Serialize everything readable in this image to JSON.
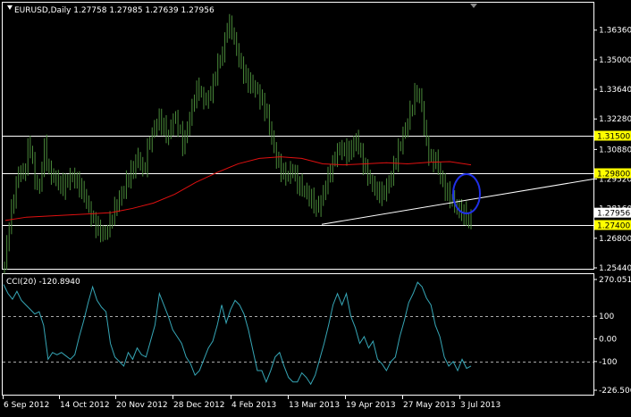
{
  "header": {
    "symbol_line": "EURUSD,Daily  1.27758 1.27985 1.27639 1.27956"
  },
  "indicator": {
    "title": "CCI(20) -120.8940",
    "axis_labels": [
      "270.051",
      "100",
      "0.00",
      "-100",
      "-226.5064"
    ],
    "level_values": [
      270.051,
      100,
      0,
      -100,
      -226.5064
    ]
  },
  "price_axis": {
    "labels": [
      "1.36360",
      "1.35000",
      "1.33640",
      "1.32280",
      "1.30880",
      "1.29520",
      "1.28160",
      "1.26800",
      "1.25440"
    ],
    "values": [
      1.3636,
      1.35,
      1.3364,
      1.3228,
      1.3088,
      1.2952,
      1.2816,
      1.268,
      1.2544
    ],
    "current_price": "1.27956",
    "current_value": 1.27956
  },
  "levels": [
    {
      "label": "1.31500",
      "value": 1.315
    },
    {
      "label": "1.29800",
      "value": 1.298
    },
    {
      "label": "1.27400",
      "value": 1.274
    }
  ],
  "time_axis": {
    "labels": [
      "6 Sep 2012",
      "14 Oct 2012",
      "20 Nov 2012",
      "28 Dec 2012",
      "4 Feb 2013",
      "13 Mar 2013",
      "19 Apr 2013",
      "27 May 2013",
      "3 Jul 2013"
    ]
  },
  "colors": {
    "background": "#000000",
    "grid_frame": "#ffffff",
    "candle": "#4a8a3a",
    "moving_average": "#e01010",
    "trendline": "#ffffff",
    "level_line": "#ffffff",
    "level_label_bg": "#ffff00",
    "cci_line": "#36a6b6",
    "highlight_circle": "#2030e8"
  },
  "chart_data": {
    "type": "candlestick",
    "symbol": "EURUSD",
    "timeframe": "Daily",
    "ohlc_last": {
      "open": 1.27758,
      "high": 1.27985,
      "low": 1.27639,
      "close": 1.27956
    },
    "x_labels": [
      "6 Sep 2012",
      "14 Oct 2012",
      "20 Nov 2012",
      "28 Dec 2012",
      "4 Feb 2013",
      "13 Mar 2013",
      "19 Apr 2013",
      "27 May 2013",
      "3 Jul 2013"
    ],
    "ylim": [
      1.2544,
      1.3758
    ],
    "close_path": [
      1.2555,
      1.2752,
      1.2882,
      1.3002,
      1.2962,
      1.3142,
      1.2962,
      1.2896,
      1.3102,
      1.2982,
      1.2962,
      1.2932,
      1.2912,
      1.2962,
      1.2962,
      1.2922,
      1.2887,
      1.2812,
      1.2752,
      1.2722,
      1.2692,
      1.2732,
      1.2802,
      1.2852,
      1.2902,
      1.2962,
      1.3002,
      1.3062,
      1.2972,
      1.3112,
      1.3172,
      1.3232,
      1.3192,
      1.3142,
      1.3232,
      1.3202,
      1.3102,
      1.3202,
      1.3302,
      1.3382,
      1.3312,
      1.3322,
      1.3382,
      1.3482,
      1.3532,
      1.3672,
      1.3622,
      1.3522,
      1.3452,
      1.3402,
      1.3382,
      1.3352,
      1.3302,
      1.3242,
      1.3122,
      1.3032,
      1.2982,
      1.2962,
      1.3002,
      1.2932,
      1.2912,
      1.2882,
      1.2852,
      1.2812,
      1.2862,
      1.2952,
      1.3012,
      1.3082,
      1.3092,
      1.3072,
      1.3092,
      1.3142,
      1.3042,
      1.2982,
      1.2932,
      1.2892,
      1.2882,
      1.2912,
      1.2972,
      1.3052,
      1.3132,
      1.3192,
      1.3282,
      1.3362,
      1.3302,
      1.3112,
      1.3032,
      1.3042,
      1.2952,
      1.2892,
      1.2862,
      1.2822,
      1.2802,
      1.2782,
      1.2752
    ],
    "ma_path": [
      1.2762,
      1.2777,
      1.2782,
      1.2787,
      1.2792,
      1.2798,
      1.2817,
      1.2842,
      1.2882,
      1.2937,
      1.2982,
      1.3022,
      1.3047,
      1.3054,
      1.3047,
      1.3022,
      1.3017,
      1.3022,
      1.3027,
      1.3022,
      1.3029,
      1.3032,
      1.3017
    ],
    "levels": [
      1.315,
      1.298,
      1.274
    ],
    "trendline": {
      "from": {
        "x": "13 Mar 2013",
        "y": 1.2744
      },
      "to": {
        "x": "after 3 Jul 2013",
        "y": 1.2952
      }
    },
    "highlight": "circle around early-July 2013 price action",
    "cci": {
      "period": 20,
      "value": -120.894,
      "ylim": [
        -226.5064,
        270.051
      ],
      "levels": [
        100,
        -100
      ],
      "path": [
        240,
        200,
        175,
        210,
        170,
        150,
        130,
        110,
        120,
        60,
        -90,
        -60,
        -70,
        -60,
        -75,
        -90,
        -70,
        10,
        80,
        160,
        230,
        170,
        140,
        120,
        -20,
        -80,
        -100,
        -120,
        -60,
        -90,
        -40,
        -70,
        -80,
        -10,
        60,
        200,
        150,
        100,
        40,
        10,
        -20,
        -80,
        -110,
        -160,
        -140,
        -90,
        -40,
        -10,
        60,
        150,
        70,
        130,
        170,
        150,
        110,
        40,
        -50,
        -140,
        -140,
        -190,
        -140,
        -80,
        -60,
        -120,
        -170,
        -190,
        -190,
        -150,
        -170,
        -200,
        -160,
        -90,
        -20,
        60,
        150,
        200,
        150,
        200,
        100,
        50,
        -20,
        10,
        -40,
        -10,
        -90,
        -110,
        -140,
        -100,
        -80,
        10,
        80,
        160,
        200,
        250,
        230,
        180,
        150,
        60,
        10,
        -80,
        -120,
        -100,
        -140,
        -90,
        -130,
        -120
      ]
    }
  }
}
